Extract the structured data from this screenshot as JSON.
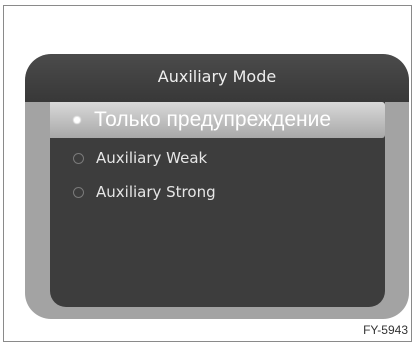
{
  "screen": {
    "title": "Auxiliary Mode",
    "items": [
      {
        "label": "Только предупреждение",
        "selected": true
      },
      {
        "label": "Auxiliary Weak",
        "selected": false
      },
      {
        "label": "Auxiliary Strong",
        "selected": false
      }
    ]
  },
  "figure": {
    "code": "FY-5943"
  },
  "colors": {
    "header": "#3f3f3f",
    "panel": "#3d3d3d",
    "bezel": "#a3a3a3",
    "highlight": "#c4c4c4"
  }
}
